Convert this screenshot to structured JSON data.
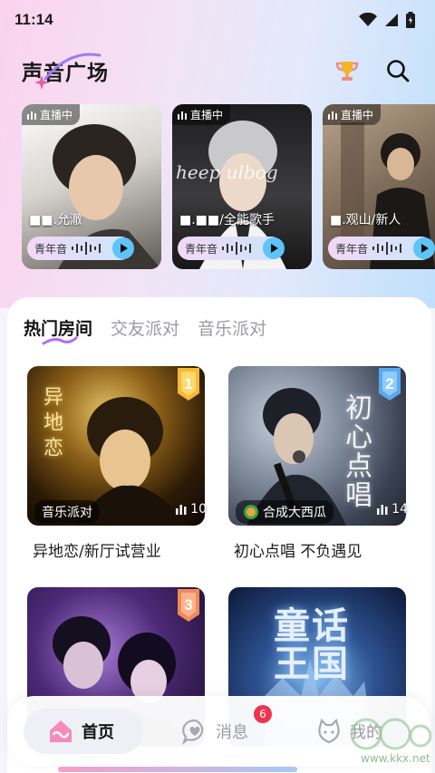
{
  "status_bar": {
    "time": "11:14"
  },
  "header": {
    "title": "声音广场"
  },
  "live_rooms": [
    {
      "badge": "直播中",
      "name": "■■.允澈",
      "voice": "青年音"
    },
    {
      "badge": "直播中",
      "name": "■.■■/全能歌手",
      "voice": "青年音"
    },
    {
      "badge": "直播中",
      "name": "■.观山/新人",
      "voice": "青年音"
    }
  ],
  "tabs": [
    {
      "label": "热门房间",
      "active": true
    },
    {
      "label": "交友派对",
      "active": false
    },
    {
      "label": "音乐派对",
      "active": false
    }
  ],
  "rooms": [
    {
      "category": "音乐派对",
      "count": "10",
      "title": "异地恋/新厅试营业",
      "rank": "1",
      "cover_text": "异地恋"
    },
    {
      "category": "合成大西瓜",
      "count": "14",
      "title": "初心点唱 不负遇见",
      "rank": "2",
      "cover_text": "初心点唱"
    },
    {
      "category": "",
      "count": "",
      "title": "",
      "rank": "3",
      "cover_text": ""
    },
    {
      "category": "",
      "count": "",
      "title": "",
      "rank": "",
      "cover_text": "童话王国"
    }
  ],
  "nav": {
    "home": "首页",
    "messages": "消息",
    "messages_badge": "6",
    "me": "我的"
  },
  "watermark": {
    "text": "www.kkx.net"
  },
  "colors": {
    "accent_blue": "#5ec3f8",
    "badge_red": "#f0334b",
    "gradient_pink": "#fbd3ee",
    "gradient_blue": "#bfe0fb"
  }
}
